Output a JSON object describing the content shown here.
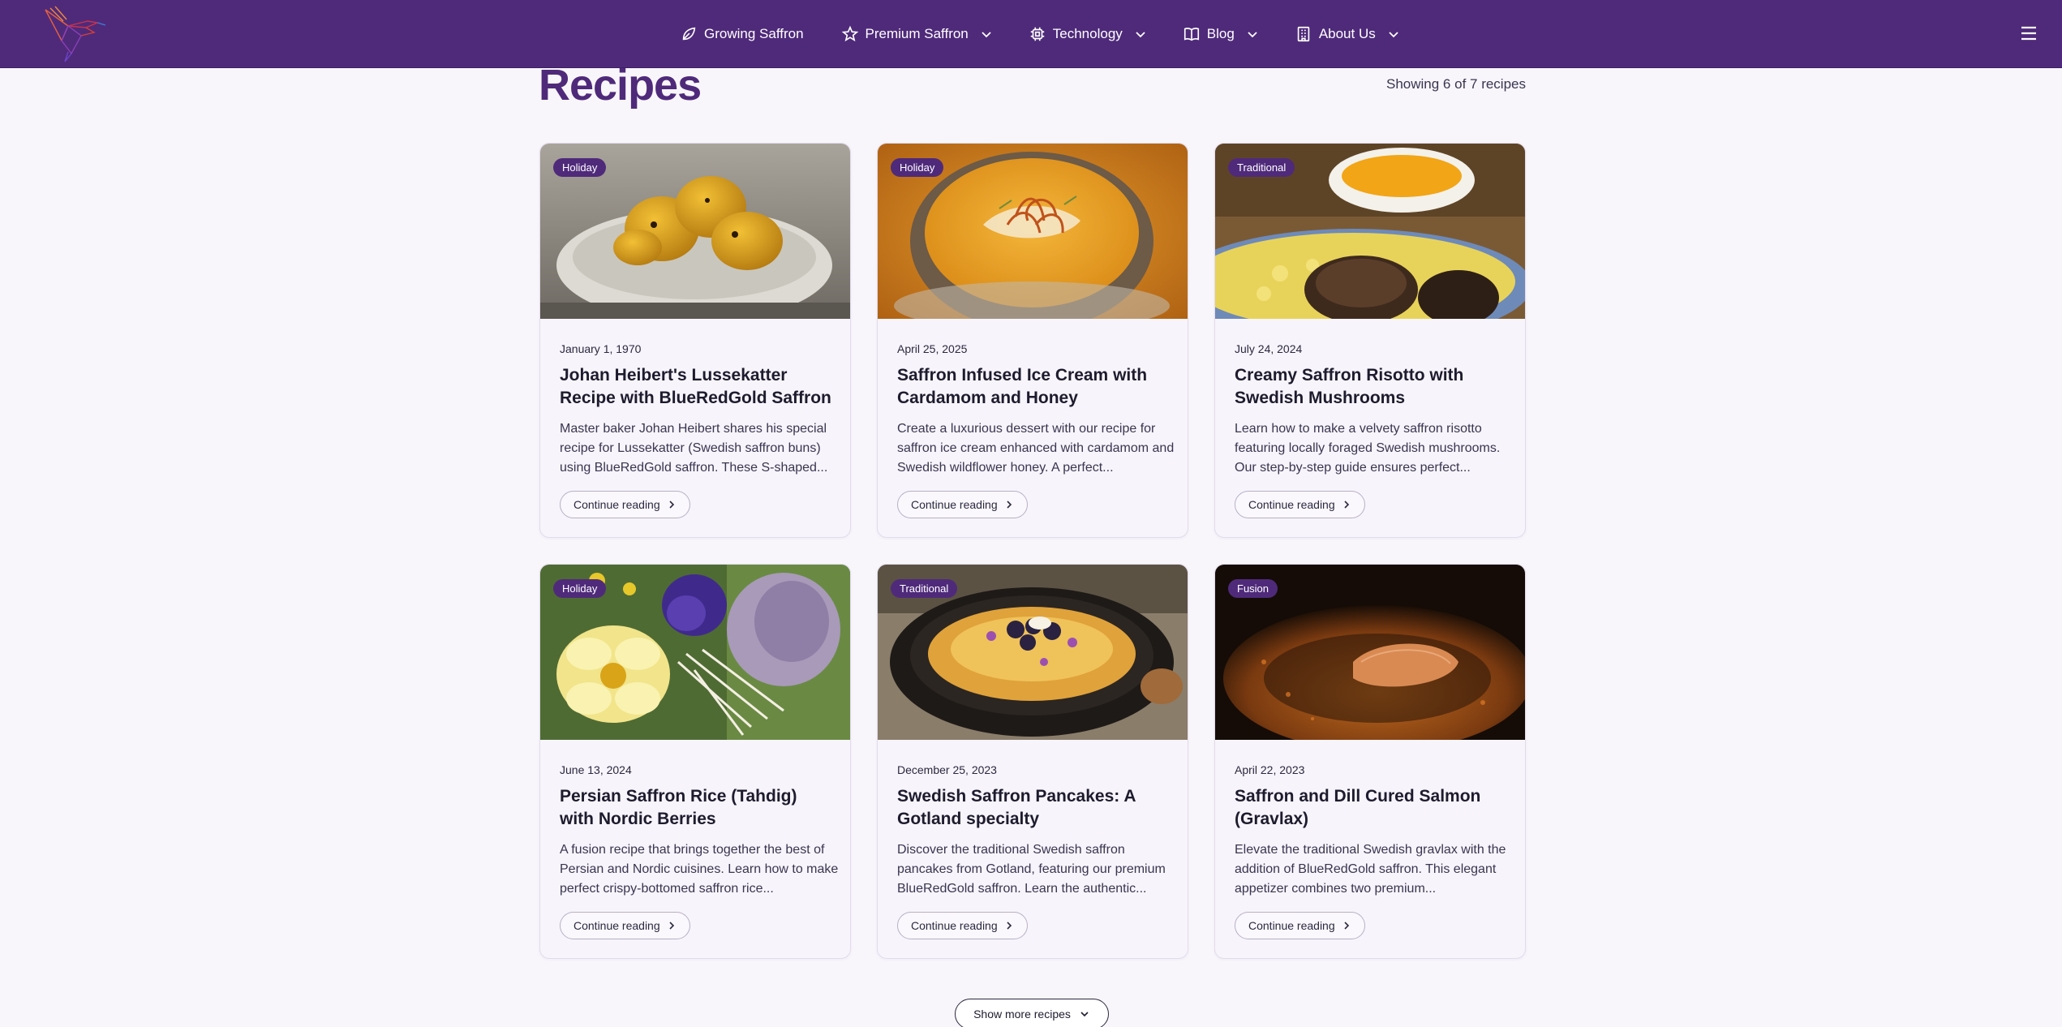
{
  "nav": {
    "items": [
      {
        "label": "Growing Saffron",
        "icon": "leaf-icon",
        "has_dropdown": false
      },
      {
        "label": "Premium Saffron",
        "icon": "star-icon",
        "has_dropdown": true
      },
      {
        "label": "Technology",
        "icon": "chip-icon",
        "has_dropdown": true
      },
      {
        "label": "Blog",
        "icon": "book-icon",
        "has_dropdown": true
      },
      {
        "label": "About Us",
        "icon": "building-icon",
        "has_dropdown": true
      }
    ]
  },
  "page": {
    "title": "Recipes",
    "count": "Showing 6 of 7 recipes"
  },
  "recipes": [
    {
      "badge": "Holiday",
      "date": "January 1, 1970",
      "title": "Johan Heibert's Lussekatter Recipe with BlueRedGold Saffron",
      "desc": "Master baker Johan Heibert shares his special recipe for Lussekatter (Swedish saffron buns) using BlueRedGold saffron. These S-shaped...",
      "cta": "Continue reading"
    },
    {
      "badge": "Holiday",
      "date": "April 25, 2025",
      "title": "Saffron Infused Ice Cream with Cardamom and Honey",
      "desc": "Create a luxurious dessert with our recipe for saffron ice cream enhanced with cardamom and Swedish wildflower honey. A perfect...",
      "cta": "Continue reading"
    },
    {
      "badge": "Traditional",
      "date": "July 24, 2024",
      "title": "Creamy Saffron Risotto with Swedish Mushrooms",
      "desc": "Learn how to make a velvety saffron risotto featuring locally foraged Swedish mushrooms. Our step-by-step guide ensures perfect...",
      "cta": "Continue reading"
    },
    {
      "badge": "Holiday",
      "date": "June 13, 2024",
      "title": "Persian Saffron Rice (Tahdig) with Nordic Berries",
      "desc": "A fusion recipe that brings together the best of Persian and Nordic cuisines. Learn how to make perfect crispy-bottomed saffron rice...",
      "cta": "Continue reading"
    },
    {
      "badge": "Traditional",
      "date": "December 25, 2023",
      "title": "Swedish Saffron Pancakes: A Gotland specialty",
      "desc": "Discover the traditional Swedish saffron pancakes from Gotland, featuring our premium BlueRedGold saffron. Learn the authentic...",
      "cta": "Continue reading"
    },
    {
      "badge": "Fusion",
      "date": "April 22, 2023",
      "title": "Saffron and Dill Cured Salmon (Gravlax)",
      "desc": "Elevate the traditional Swedish gravlax with the addition of BlueRedGold saffron. This elegant appetizer combines two premium...",
      "cta": "Continue reading"
    }
  ],
  "show_more": "Show more recipes",
  "colors": {
    "brand": "#4f2a7a",
    "background": "#f8f6fb"
  }
}
